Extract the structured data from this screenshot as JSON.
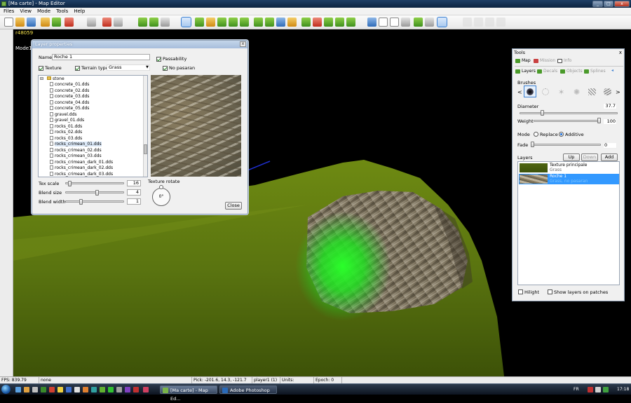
{
  "window": {
    "title": "[Ma carte] - Map Editor",
    "min": "_",
    "max": "□",
    "close": "x"
  },
  "menu": [
    "Files",
    "View",
    "Mode",
    "Tools",
    "Help"
  ],
  "viewport": {
    "coord_text": "r48059",
    "model_text": "Mode1"
  },
  "layer_dialog": {
    "title": "Layer properties",
    "close_x": "x",
    "name_label": "Name",
    "name_value": "Roche 1",
    "passability_label": "Passability",
    "passability_checked": true,
    "texture_label": "Texture",
    "texture_checked": true,
    "terrain_type_label": "Terrain type",
    "terrain_type_checked": true,
    "terrain_type_value": "Grass",
    "no_pasaran_label": "No pasaran",
    "no_pasaran_checked": true,
    "tree": {
      "folder": "stone",
      "files": [
        "concrete_01.dds",
        "concrete_02.dds",
        "concrete_03.dds",
        "concrete_04.dds",
        "concrete_05.dds",
        "gravel.dds",
        "gravel_01.dds",
        "rocks_01.dds",
        "rocks_02.dds",
        "rocks_03.dds",
        "rocks_crimean_01.dds",
        "rocks_crimean_02.dds",
        "rocks_crimean_03.dds",
        "rocks_crimean_dark_01.dds",
        "rocks_crimean_dark_02.dds",
        "rocks_crimean_dark_03.dds"
      ],
      "selected": "rocks_crimean_01.dds"
    },
    "tex_scale_label": "Tex scale",
    "tex_scale_value": "16",
    "tex_scale_level": 0.05,
    "blend_size_label": "Blend size",
    "blend_size_value": "4",
    "blend_size_level": 0.55,
    "blend_width_label": "Blend width",
    "blend_width_value": "1",
    "blend_width_level": 0.25,
    "texture_rotate_label": "Texture rotate",
    "rotate_value": "0°",
    "close_button": "Close"
  },
  "tools_panel": {
    "title": "Tools",
    "close_x": "x",
    "top_tabs": [
      {
        "label": "Map",
        "active": true
      },
      {
        "label": "Mission",
        "active": false
      },
      {
        "label": "Info",
        "active": false
      }
    ],
    "sub_tabs": [
      {
        "label": "Layers",
        "active": true
      },
      {
        "label": "Decals",
        "active": false
      },
      {
        "label": "Objects",
        "active": false
      },
      {
        "label": "Splines",
        "active": false
      }
    ],
    "brushes_label": "Brushes",
    "prev_arrow": "<",
    "next_arrow": ">",
    "diameter_label": "Diameter",
    "diameter_value": "37.7",
    "diameter_level": 0.22,
    "weight_label": "Weight",
    "weight_value": "100",
    "weight_level": 1.0,
    "mode_label": "Mode",
    "mode_replace": "Replace",
    "mode_additive": "Additive",
    "mode_selected": "Additive",
    "fade_label": "Fade",
    "fade_value": "0",
    "fade_level": 0.0,
    "layers_label": "Layers",
    "up_button": "Up",
    "down_button": "Down",
    "add_button": "Add",
    "layers": [
      {
        "name": "Texture principale",
        "sub": "Grass",
        "selected": false
      },
      {
        "name": "Roche 1",
        "sub": "Grass, no pasaran",
        "selected": true
      }
    ],
    "hilight_label": "Hilight",
    "show_layers_label": "Show layers on patches"
  },
  "status": {
    "fps": "FPS: 839.79",
    "mode": "none",
    "pick": "Pick: -201.6, 14.3, -121.7",
    "player": "player1 (1)",
    "units": "Units:",
    "epoch": "Epoch: 0"
  },
  "taskbar": {
    "tasks": [
      {
        "label": "[Ma carte] - Map Ed...",
        "active": true
      },
      {
        "label": "Adobe Photoshop",
        "active": false
      }
    ],
    "lang": "FR",
    "clock": "17:18"
  },
  "colors": {
    "accent": "#3399ff",
    "title_bar": "#0b2340",
    "terrain_green": "#5f7a10",
    "brush_glow": "#22ff22"
  }
}
